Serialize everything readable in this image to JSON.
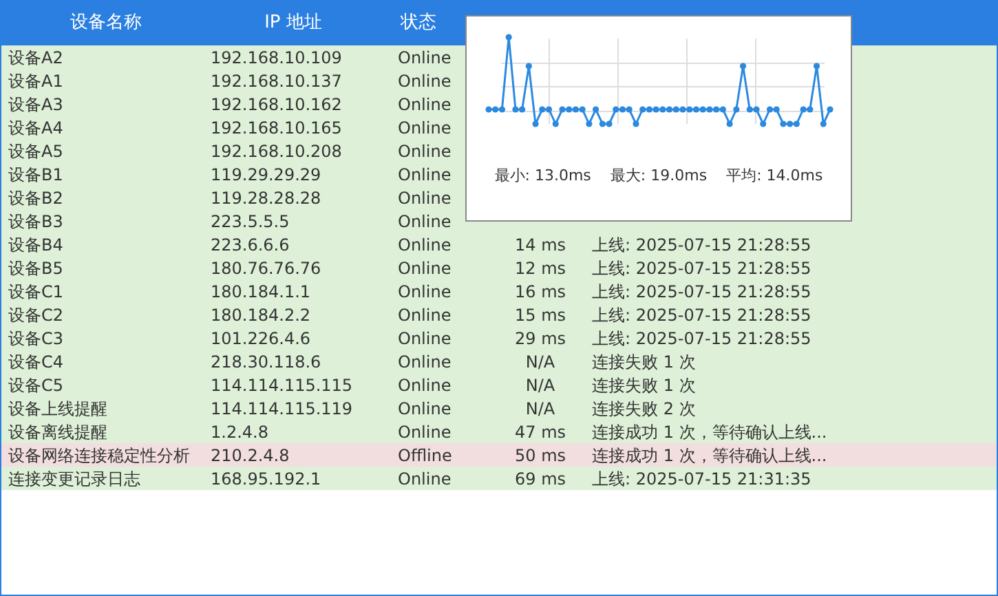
{
  "table": {
    "columns": [
      "设备名称",
      "IP 地址",
      "状态"
    ],
    "rows": [
      {
        "name": "设备A2",
        "ip": "192.168.10.109",
        "status": "Online",
        "kind": "online"
      },
      {
        "name": "设备A1",
        "ip": "192.168.10.137",
        "status": "Online",
        "kind": "online"
      },
      {
        "name": "设备A3",
        "ip": "192.168.10.162",
        "status": "Online",
        "kind": "online"
      },
      {
        "name": "设备A4",
        "ip": "192.168.10.165",
        "status": "Online",
        "kind": "online"
      },
      {
        "name": "设备A5",
        "ip": "192.168.10.208",
        "status": "Online",
        "kind": "online"
      },
      {
        "name": "设备B1",
        "ip": "119.29.29.29",
        "status": "Online",
        "kind": "online"
      },
      {
        "name": "设备B2",
        "ip": "119.28.28.28",
        "status": "Online",
        "kind": "online"
      },
      {
        "name": "设备B3",
        "ip": "223.5.5.5",
        "status": "Online",
        "kind": "online"
      },
      {
        "name": "设备B4",
        "ip": "223.6.6.6",
        "status": "Online",
        "latency": "14 ms",
        "detail": "上线: 2025-07-15 21:28:55",
        "kind": "online"
      },
      {
        "name": "设备B5",
        "ip": "180.76.76.76",
        "status": "Online",
        "latency": "12 ms",
        "detail": "上线: 2025-07-15 21:28:55",
        "kind": "online"
      },
      {
        "name": "设备C1",
        "ip": "180.184.1.1",
        "status": "Online",
        "latency": "16 ms",
        "detail": "上线: 2025-07-15 21:28:55",
        "kind": "online"
      },
      {
        "name": "设备C2",
        "ip": "180.184.2.2",
        "status": "Online",
        "latency": "15 ms",
        "detail": "上线: 2025-07-15 21:28:55",
        "kind": "online"
      },
      {
        "name": "设备C3",
        "ip": "101.226.4.6",
        "status": "Online",
        "latency": "29 ms",
        "detail": "上线: 2025-07-15 21:28:55",
        "kind": "online"
      },
      {
        "name": "设备C4",
        "ip": "218.30.118.6",
        "status": "Online",
        "latency": "N/A",
        "detail": "连接失败 1 次",
        "kind": "online"
      },
      {
        "name": "设备C5",
        "ip": "114.114.115.115",
        "status": "Online",
        "latency": "N/A",
        "detail": "连接失败 1 次",
        "kind": "online"
      },
      {
        "name": "设备上线提醒",
        "ip": "114.114.115.119",
        "status": "Online",
        "latency": "N/A",
        "detail": "连接失败 2 次",
        "kind": "online"
      },
      {
        "name": "设备离线提醒",
        "ip": "1.2.4.8",
        "status": "Online",
        "latency": "47 ms",
        "detail": "连接成功 1 次，等待确认上线...",
        "kind": "online"
      },
      {
        "name": "设备网络连接稳定性分析",
        "ip": "210.2.4.8",
        "status": "Offline",
        "latency": "50 ms",
        "detail": "连接成功 1 次，等待确认上线...",
        "kind": "offline"
      },
      {
        "name": "连接变更记录日志",
        "ip": "168.95.192.1",
        "status": "Online",
        "latency": "69 ms",
        "detail": "上线: 2025-07-15 21:31:35",
        "kind": "online"
      }
    ]
  },
  "tooltip": {
    "stats": [
      "最小: 13.0ms",
      "最大: 19.0ms",
      "平均: 14.0ms"
    ]
  }
}
